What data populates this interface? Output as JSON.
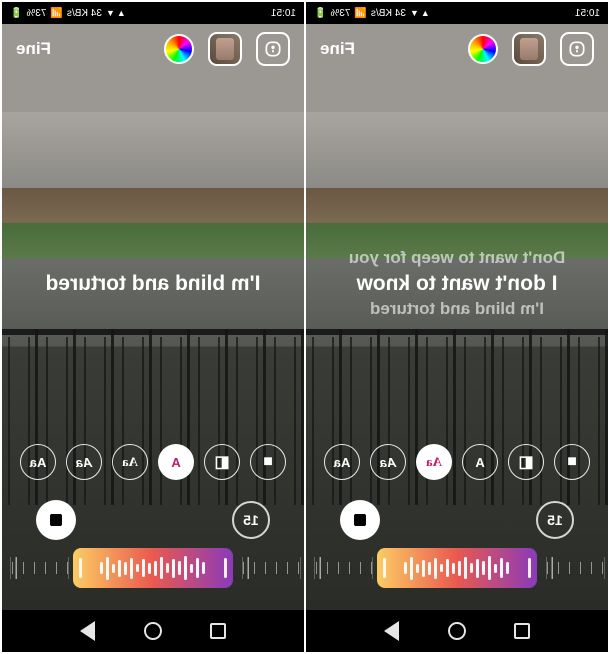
{
  "status": {
    "time": "10:51",
    "battery": "73%",
    "network": "34 KB/s"
  },
  "editor": {
    "done_label": "Fine",
    "duration_seconds": "15"
  },
  "left_screen": {
    "lyrics": {
      "main": "I'm blind and tortured"
    },
    "font_options": [
      "solid-cube",
      "outline-cube",
      "Aa-badge",
      "Aa-serif",
      "Aa-script",
      "Aa-bold"
    ],
    "selected_font_index": 2
  },
  "right_screen": {
    "lyrics": {
      "prev": "Don't want to weep for you",
      "main": "I don't want to know",
      "next": "I'm blind and tortured"
    },
    "font_options": [
      "solid-cube",
      "outline-cube",
      "Aa-badge",
      "Aa-serif",
      "Aa-script",
      "Aa-bold"
    ],
    "selected_font_index": 3
  },
  "font_option_glyphs": {
    "solid-cube": "■",
    "outline-cube": "◧",
    "Aa-badge": "A",
    "Aa-serif": "Aa",
    "Aa-script": "Aa",
    "Aa-bold": "Aa"
  }
}
